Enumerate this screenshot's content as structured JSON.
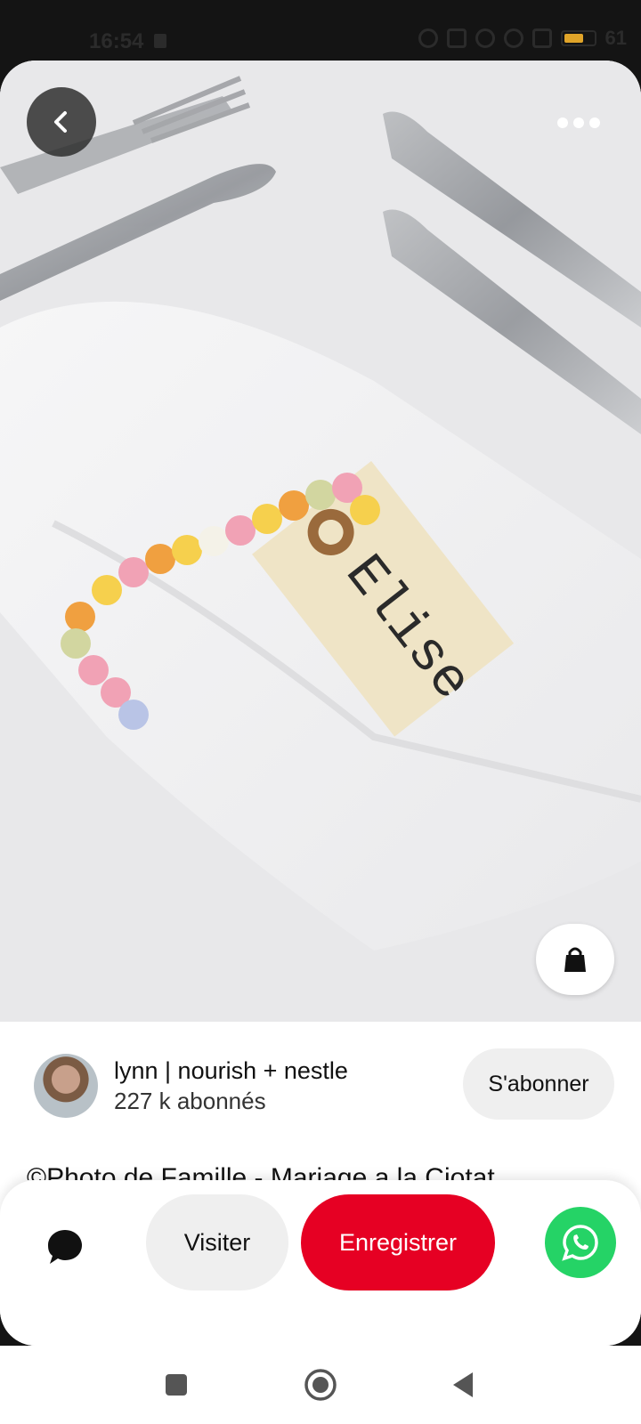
{
  "status_bar": {
    "time": "16:54",
    "battery_percent": 61,
    "battery_label": "61"
  },
  "photo": {
    "tag_text": "Elise"
  },
  "creator": {
    "name": "lynn | nourish + nestle",
    "followers": "227 k abonnés",
    "follow_label": "S'abonner"
  },
  "pin": {
    "title": "©Photo de Famille - Mariage a la Ciotat"
  },
  "actions": {
    "visit_label": "Visiter",
    "save_label": "Enregistrer"
  },
  "colors": {
    "save_red": "#e60023",
    "whatsapp_green": "#25d366",
    "battery_yellow": "#e0a429"
  },
  "icons": {
    "back": "chevron-left-icon",
    "more": "more-horizontal-icon",
    "shop": "shopping-bag-icon",
    "comment": "speech-bubble-icon",
    "share": "whatsapp-icon",
    "nav_recent": "square-icon",
    "nav_home": "circle-icon",
    "nav_back": "triangle-back-icon"
  }
}
